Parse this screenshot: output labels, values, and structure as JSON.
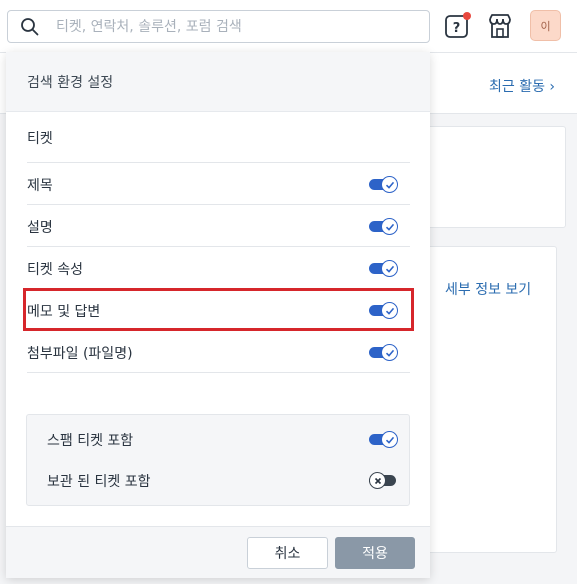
{
  "search": {
    "placeholder": "티켓, 연락처, 솔루션, 포럼 검색"
  },
  "header": {
    "avatar_initial": "이"
  },
  "background": {
    "recent_activity_link": "최근 활동 ›",
    "view_details_link": "세부 정보 보기"
  },
  "panel": {
    "title": "검색 환경 설정",
    "section_title": "티켓",
    "options": [
      {
        "label": "제목",
        "checked": true
      },
      {
        "label": "설명",
        "checked": true
      },
      {
        "label": "티켓 속성",
        "checked": true
      },
      {
        "label": "메모 및 답변",
        "checked": true
      },
      {
        "label": "첨부파일 (파일명)",
        "checked": true
      }
    ],
    "extra_options": [
      {
        "label": "스팸 티켓 포함",
        "checked": true
      },
      {
        "label": "보관 된 티켓 포함",
        "checked": false
      }
    ],
    "cancel_label": "취소",
    "apply_label": "적용"
  },
  "colors": {
    "toggle_on": "#2d63c8",
    "toggle_off": "#3b4550",
    "highlight": "#d6262b",
    "link": "#2b6cb0"
  }
}
